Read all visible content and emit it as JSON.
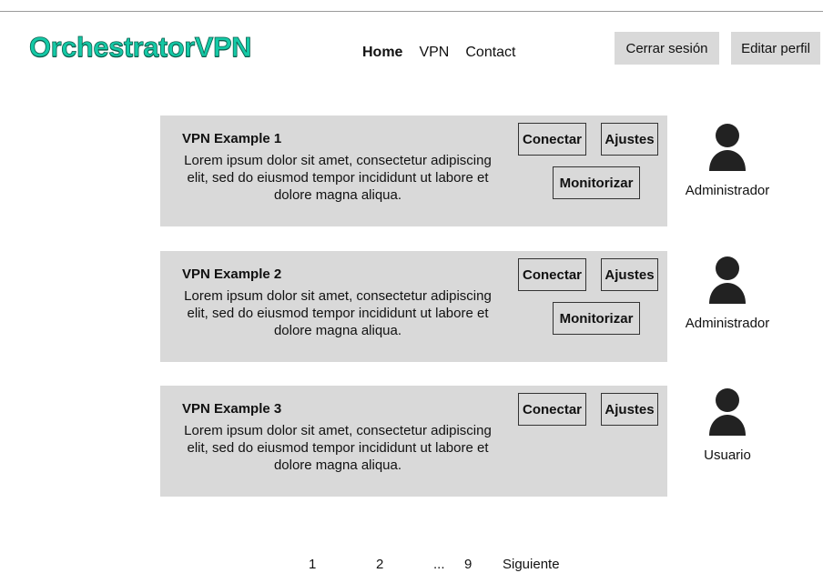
{
  "header": {
    "logo": "OrchestratorVPN",
    "nav": [
      {
        "label": "Home",
        "active": true
      },
      {
        "label": "VPN",
        "active": false
      },
      {
        "label": "Contact",
        "active": false
      }
    ],
    "logout_label": "Cerrar sesión",
    "profile_label": "Editar perfil"
  },
  "colors": {
    "logo": "#14c9a6",
    "card_bg": "#d9d9d9",
    "button_bg": "#d9d9d9",
    "icon": "#222222"
  },
  "vpns": [
    {
      "title": "VPN Example 1",
      "description": "Lorem ipsum dolor sit amet, consectetur adipiscing elit, sed do eiusmod tempor incididunt ut labore et dolore magna aliqua.",
      "connect_label": "Conectar",
      "settings_label": "Ajustes",
      "monitor_label": "Monitorizar",
      "role_icon": "user-icon",
      "role": "Administrador"
    },
    {
      "title": "VPN Example 2",
      "description": "Lorem ipsum dolor sit amet, consectetur adipiscing elit, sed do eiusmod tempor incididunt ut labore et dolore magna aliqua.",
      "connect_label": "Conectar",
      "settings_label": "Ajustes",
      "monitor_label": "Monitorizar",
      "role_icon": "user-icon",
      "role": "Administrador"
    },
    {
      "title": "VPN Example 3",
      "description": "Lorem ipsum dolor sit amet, consectetur adipiscing elit, sed do eiusmod tempor incididunt ut labore et dolore magna aliqua.",
      "connect_label": "Conectar",
      "settings_label": "Ajustes",
      "role_icon": "user-icon",
      "role": "Usuario"
    }
  ],
  "pagination": {
    "pages": [
      "1",
      "2",
      "...",
      "9"
    ],
    "next_label": "Siguiente"
  }
}
